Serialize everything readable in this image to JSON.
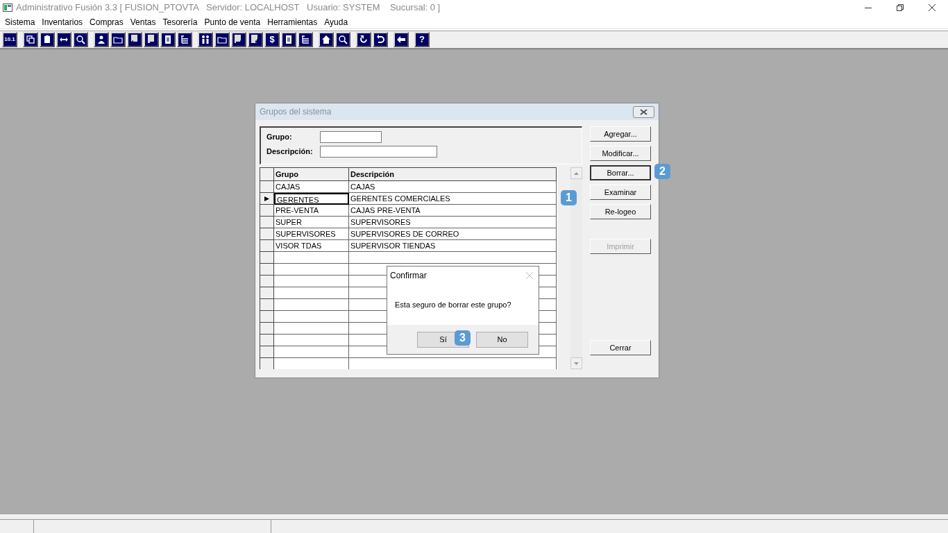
{
  "window": {
    "title": "Administrativo Fusión 3.3 [ FUSION_PTOVTA   Servidor: LOCALHOST   Usuario: SYSTEM    Sucursal: 0 ]"
  },
  "menu": [
    "Sistema",
    "Inventarios",
    "Compras",
    "Ventas",
    "Tesorería",
    "Punto de venta",
    "Herramientas",
    "Ayuda"
  ],
  "toolbar": [
    [
      {
        "kind": "text",
        "text": "10.1"
      }
    ],
    [
      {
        "kind": "copy"
      },
      {
        "kind": "clipboard"
      },
      {
        "kind": "swap"
      },
      {
        "kind": "search"
      }
    ],
    [
      {
        "kind": "person"
      },
      {
        "kind": "folder"
      },
      {
        "kind": "doc-left"
      },
      {
        "kind": "doc-minus"
      },
      {
        "kind": "doc"
      },
      {
        "kind": "tree"
      }
    ],
    [
      {
        "kind": "people"
      },
      {
        "kind": "folder"
      },
      {
        "kind": "doc-right"
      },
      {
        "kind": "doc-plus"
      },
      {
        "kind": "text",
        "text": "$"
      },
      {
        "kind": "doc"
      },
      {
        "kind": "tree"
      }
    ],
    [
      {
        "kind": "home"
      },
      {
        "kind": "search"
      }
    ],
    [
      {
        "kind": "redo"
      },
      {
        "kind": "undo"
      }
    ],
    [
      {
        "kind": "back"
      }
    ],
    [
      {
        "kind": "text",
        "text": "?"
      }
    ]
  ],
  "child_window": {
    "title": "Grupos del sistema",
    "filters": [
      {
        "label": "Grupo:"
      },
      {
        "label": "Descripción:"
      }
    ],
    "table": {
      "columns": [
        "Grupo",
        "Descripción"
      ],
      "rows": [
        {
          "cells": [
            "CAJAS",
            "CAJAS"
          ],
          "selected": false
        },
        {
          "cells": [
            "GERENTES",
            "GERENTES COMERCIALES"
          ],
          "selected": true
        },
        {
          "cells": [
            "PRE-VENTA",
            "CAJAS PRE-VENTA"
          ],
          "selected": false
        },
        {
          "cells": [
            "SUPER",
            "SUPERVISORES"
          ],
          "selected": false
        },
        {
          "cells": [
            "SUPERVISORES",
            "SUPERVISORES DE CORREO"
          ],
          "selected": false
        },
        {
          "cells": [
            "VISOR TDAS",
            "SUPERVISOR TIENDAS"
          ],
          "selected": false
        }
      ]
    },
    "buttons": [
      {
        "label": "Agregar...",
        "disabled": false,
        "focused": false
      },
      {
        "label": "Modificar...",
        "disabled": false,
        "focused": false
      },
      {
        "label": "Borrar...",
        "disabled": false,
        "focused": true
      },
      {
        "label": "Examinar",
        "disabled": false,
        "focused": false
      },
      {
        "label": "Re-logeo",
        "disabled": false,
        "focused": false
      },
      {
        "label": "Imprimir",
        "disabled": true,
        "focused": false
      },
      {
        "label": "Cerrar",
        "disabled": false,
        "focused": false
      }
    ]
  },
  "confirm_dialog": {
    "title": "Confirmar",
    "message": "Esta seguro de borrar este grupo?",
    "buttons": [
      "Sí",
      "No"
    ]
  },
  "callouts": [
    {
      "text": "1"
    },
    {
      "text": "2"
    },
    {
      "text": "3"
    }
  ]
}
